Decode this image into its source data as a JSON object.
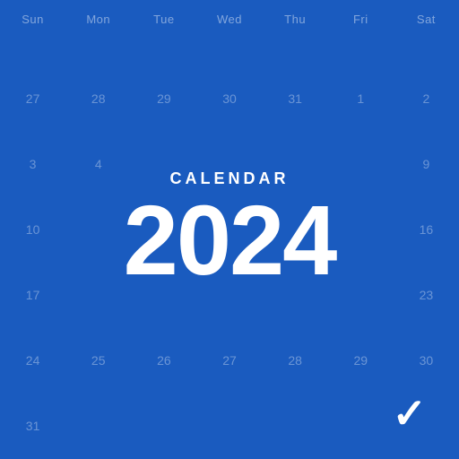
{
  "calendar": {
    "label": "CALENDAR",
    "year": "2024",
    "background_color": "#1a5bbf",
    "days_of_week": [
      "Sun",
      "Mon",
      "Tue",
      "Wed",
      "Thu",
      "Fri",
      "Sat"
    ],
    "weeks": [
      [
        "27",
        "28",
        "29",
        "30",
        "31",
        "1",
        "2"
      ],
      [
        "3",
        "4",
        "",
        "",
        "",
        "",
        "9"
      ],
      [
        "10",
        "",
        "",
        "",
        "",
        "",
        "16"
      ],
      [
        "17",
        "",
        "",
        "",
        "",
        "",
        "23"
      ],
      [
        "24",
        "25",
        "26",
        "27",
        "28",
        "29",
        "30"
      ],
      [
        "31",
        "",
        "",
        "",
        "",
        "",
        ""
      ]
    ]
  }
}
